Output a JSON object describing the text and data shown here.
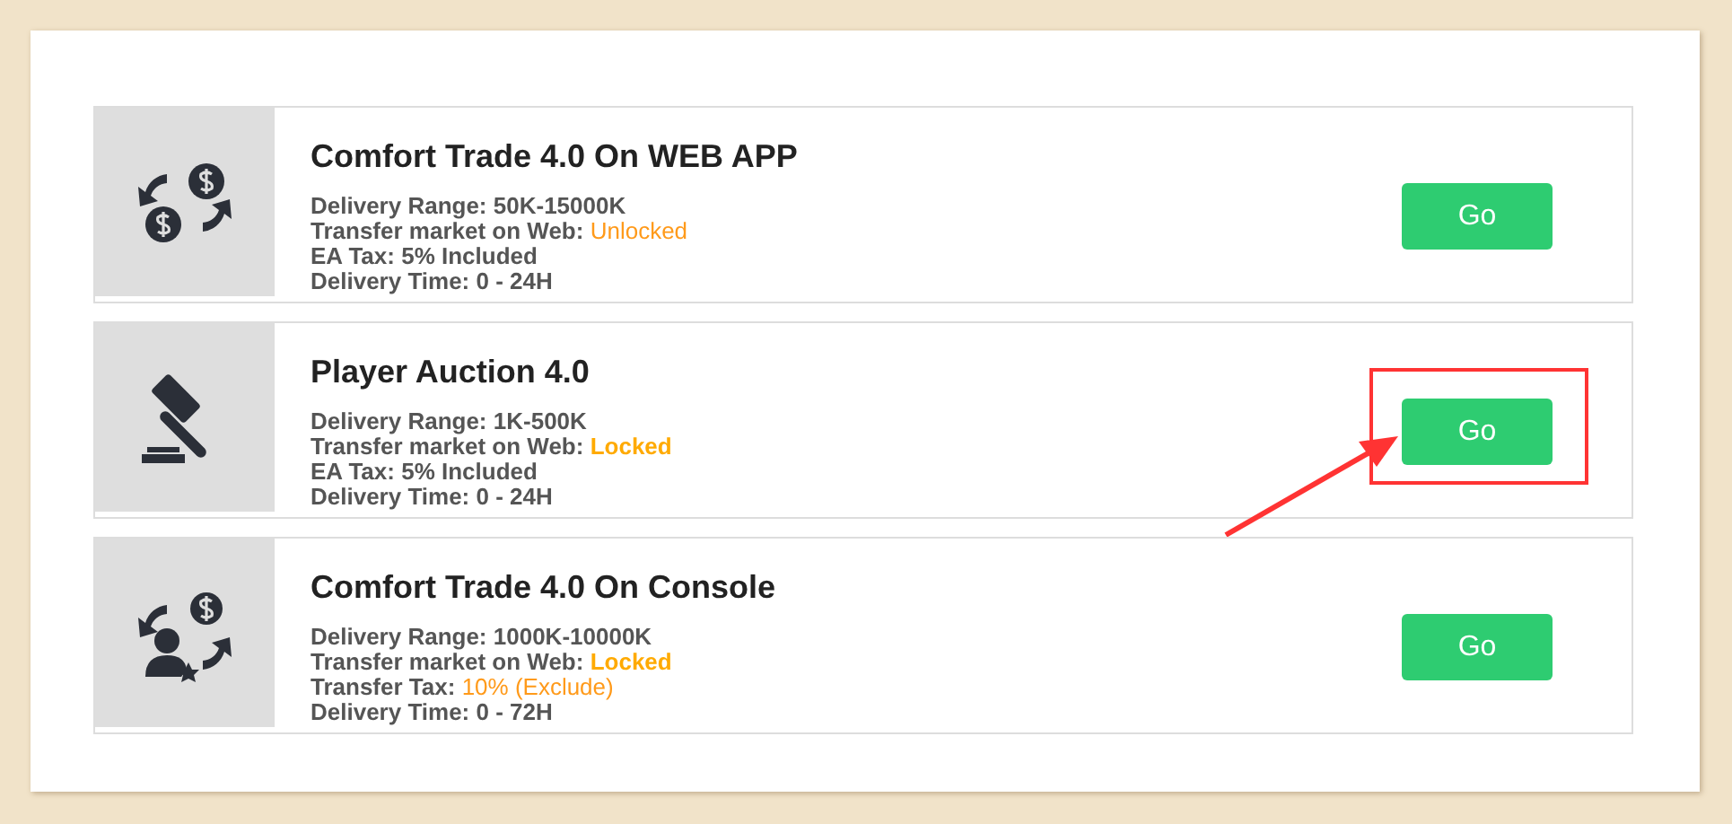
{
  "offers": [
    {
      "kind": "exchange",
      "title": "Comfort Trade 4.0 On WEB APP",
      "details": [
        {
          "label": "Delivery Range:",
          "value": "50K-15000K",
          "kind": "plain"
        },
        {
          "label": "Transfer market on Web:",
          "value": "Unlocked",
          "kind": "accent"
        },
        {
          "label": "EA Tax:",
          "value": "5% Included",
          "kind": "plain"
        },
        {
          "label": "Delivery Time:",
          "value": "0 - 24H",
          "kind": "plain"
        }
      ],
      "button": "Go",
      "highlighted": false
    },
    {
      "kind": "gavel",
      "title": "Player Auction 4.0",
      "details": [
        {
          "label": "Delivery Range:",
          "value": "1K-500K",
          "kind": "plain"
        },
        {
          "label": "Transfer market on Web:",
          "value": "Locked",
          "kind": "accent-bold"
        },
        {
          "label": "EA Tax:",
          "value": "5% Included",
          "kind": "plain"
        },
        {
          "label": "Delivery Time:",
          "value": "0 - 24H",
          "kind": "plain"
        }
      ],
      "button": "Go",
      "highlighted": true
    },
    {
      "kind": "player-exchange",
      "title": "Comfort Trade 4.0 On Console",
      "details": [
        {
          "label": "Delivery Range:",
          "value": "1000K-10000K",
          "kind": "plain"
        },
        {
          "label": "Transfer market on Web:",
          "value": "Locked",
          "kind": "accent-bold"
        },
        {
          "label": "Transfer Tax:",
          "value": "10% (Exclude)",
          "kind": "accent"
        },
        {
          "label": "Delivery Time:",
          "value": "0 - 72H",
          "kind": "plain"
        }
      ],
      "button": "Go",
      "highlighted": false
    }
  ]
}
